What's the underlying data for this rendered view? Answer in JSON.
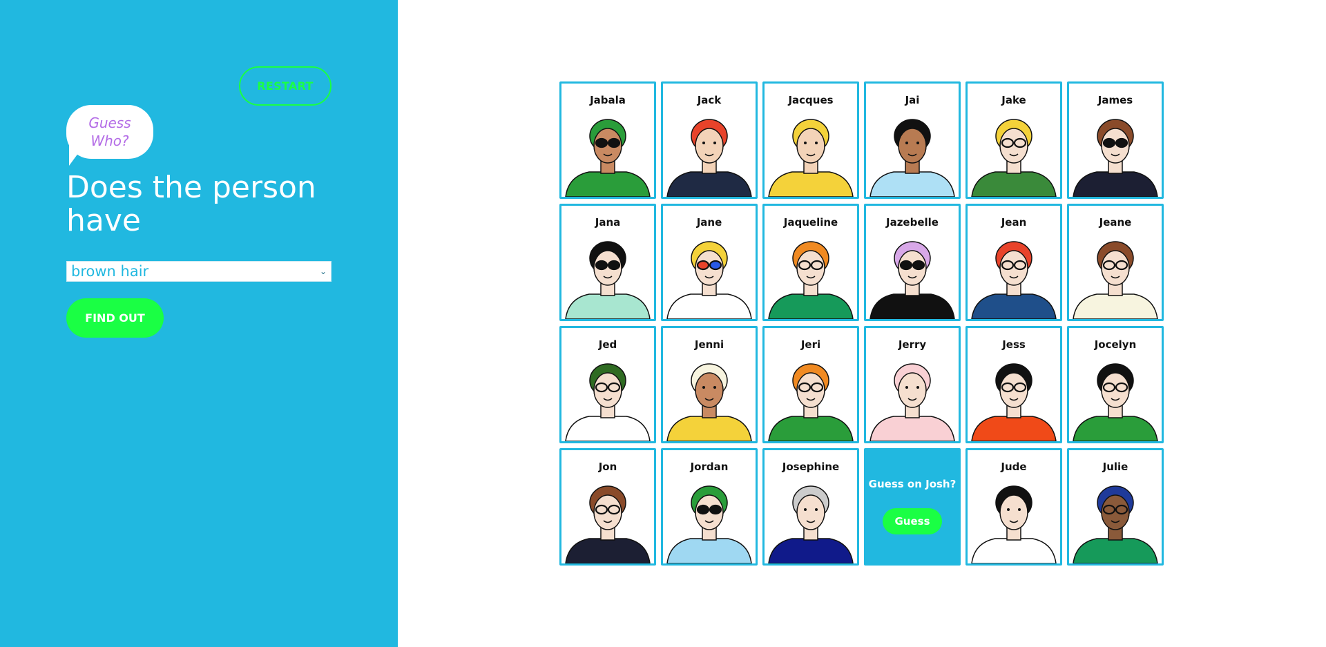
{
  "sidebar": {
    "restart_label": "RESTART",
    "logo_text": "Guess Who?",
    "question": "Does the person have",
    "selected_attribute": "brown hair",
    "findout_label": "FIND OUT"
  },
  "colors": {
    "sidebar_bg": "#21b8e0",
    "accent_green": "#1aff44",
    "logo_purple": "#b36be6",
    "card_border": "#21b8e0"
  },
  "board": {
    "cards": [
      {
        "name": "Jabala",
        "hair": "#2a9d3a",
        "skin": "#c98a62",
        "shirt": "#2a9d3a",
        "glasses": "sunglasses"
      },
      {
        "name": "Jack",
        "hair": "#e8432a",
        "skin": "#f3d3b8",
        "shirt": "#1f2a44",
        "glasses": "none"
      },
      {
        "name": "Jacques",
        "hair": "#f4d23a",
        "skin": "#f3d3b8",
        "shirt": "#f4d23a",
        "glasses": "none"
      },
      {
        "name": "Jai",
        "hair": "#111111",
        "skin": "#b87b52",
        "shirt": "#aee0f5",
        "glasses": "none"
      },
      {
        "name": "Jake",
        "hair": "#f4d23a",
        "skin": "#f5dfcf",
        "shirt": "#3a8a3a",
        "glasses": "glasses"
      },
      {
        "name": "James",
        "hair": "#8a4b2a",
        "skin": "#f5dfcf",
        "shirt": "#1c1f33",
        "glasses": "sunglasses"
      },
      {
        "name": "Jana",
        "hair": "#111111",
        "skin": "#f5dfcf",
        "shirt": "#a8e6d0",
        "glasses": "sunglasses"
      },
      {
        "name": "Jane",
        "hair": "#f4d23a",
        "skin": "#f5dfcf",
        "shirt": "#ffffff",
        "glasses": "colored"
      },
      {
        "name": "Jaqueline",
        "hair": "#f08a22",
        "skin": "#f5dfcf",
        "shirt": "#169a5a",
        "glasses": "glasses"
      },
      {
        "name": "Jazebelle",
        "hair": "#d8a8e8",
        "skin": "#f5dfcf",
        "shirt": "#111111",
        "glasses": "sunglasses"
      },
      {
        "name": "Jean",
        "hair": "#e8432a",
        "skin": "#f5dfcf",
        "shirt": "#1f4f8a",
        "glasses": "glasses"
      },
      {
        "name": "Jeane",
        "hair": "#8a4b2a",
        "skin": "#f5dfcf",
        "shirt": "#f7f4df",
        "glasses": "glasses"
      },
      {
        "name": "Jed",
        "hair": "#2f6b22",
        "skin": "#f5dfcf",
        "shirt": "#ffffff",
        "glasses": "glasses"
      },
      {
        "name": "Jenni",
        "hair": "#f7f4df",
        "skin": "#c98a62",
        "shirt": "#f4d23a",
        "glasses": "none"
      },
      {
        "name": "Jeri",
        "hair": "#f08a22",
        "skin": "#f5dfcf",
        "shirt": "#2a9d3a",
        "glasses": "glasses"
      },
      {
        "name": "Jerry",
        "hair": "#f9d0d4",
        "skin": "#f5dfcf",
        "shirt": "#f9d0d4",
        "glasses": "none"
      },
      {
        "name": "Jess",
        "hair": "#111111",
        "skin": "#f5dfcf",
        "shirt": "#f04a18",
        "glasses": "glasses"
      },
      {
        "name": "Jocelyn",
        "hair": "#111111",
        "skin": "#f5dfcf",
        "shirt": "#2a9d3a",
        "glasses": "glasses"
      },
      {
        "name": "Jon",
        "hair": "#8a4b2a",
        "skin": "#f5dfcf",
        "shirt": "#1c1f33",
        "glasses": "glasses"
      },
      {
        "name": "Jordan",
        "hair": "#2a9d3a",
        "skin": "#f5dfcf",
        "shirt": "#9fd8f2",
        "glasses": "sunglasses"
      },
      {
        "name": "Josephine",
        "hair": "#cccccc",
        "skin": "#f5dfcf",
        "shirt": "#101a8a",
        "glasses": "none"
      },
      {
        "guess": true,
        "text": "Guess on Josh?",
        "button": "Guess"
      },
      {
        "name": "Jude",
        "hair": "#111111",
        "skin": "#f5dfcf",
        "shirt": "#ffffff",
        "glasses": "none"
      },
      {
        "name": "Julie",
        "hair": "#1f3a9a",
        "skin": "#8a5a3a",
        "shirt": "#169a5a",
        "glasses": "glasses"
      }
    ]
  }
}
